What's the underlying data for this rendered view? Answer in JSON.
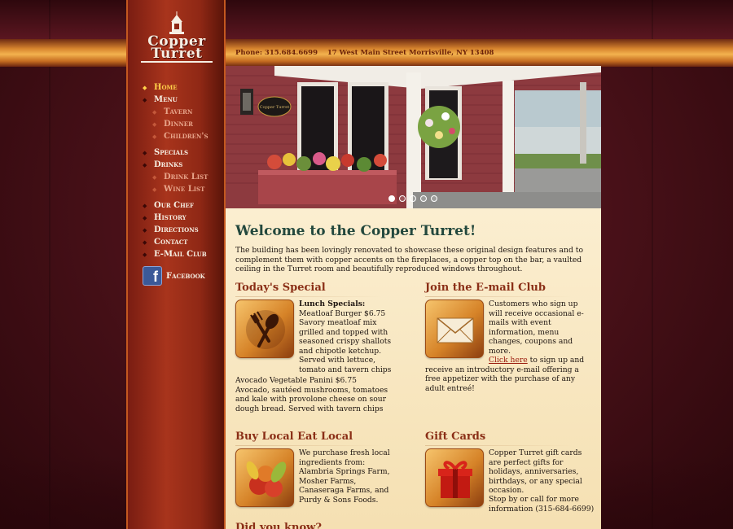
{
  "site": {
    "logo_line1": "Copper",
    "logo_line2": "Turret"
  },
  "header": {
    "contact": "Phone: 315.684.6699    17 West Main Street Morrisville, NY 13408"
  },
  "nav": {
    "home": "Home",
    "menu": "Menu",
    "tavern": "Tavern",
    "dinner": "Dinner",
    "childrens": "Children's",
    "specials": "Specials",
    "drinks": "Drinks",
    "drink_list": "Drink List",
    "wine_list": "Wine List",
    "our_chef": "Our Chef",
    "history": "History",
    "directions": "Directions",
    "contact": "Contact",
    "email_club": "E-Mail Club",
    "facebook": "Facebook"
  },
  "hero": {
    "sign_text": "Copper Turret",
    "slide_count": 5,
    "active_slide": 1
  },
  "main": {
    "welcome_title": "Welcome to the Copper Turret!",
    "intro": "The building has been lovingly renovated to showcase these original design features and to complement them with copper accents on the fireplaces, a copper top on the bar, a vaulted ceiling in the Turret room and beautifully reproduced windows throughout.",
    "special": {
      "title": "Today's Special",
      "lunch_heading": "Lunch Specials:",
      "item1": "Meatloaf Burger $6.75",
      "desc1": "Savory meatloaf mix grilled and topped with seasoned crispy shallots and chipotle ketchup. Served with lettuce, tomato and tavern chips",
      "item2": "Avocado Vegetable Panini $6.75",
      "desc2": "Avocado, sautéed mushrooms, tomatoes and kale with provolone cheese on sour dough bread. Served with tavern chips"
    },
    "email_club": {
      "title": "Join the E-mail Club",
      "text": "Customers who sign up will receive occasional e-mails with event information, menu changes, coupons and more.",
      "link": "Click here",
      "text2": " to sign up and receive an introductory e-mail offering a free appetizer with the purchase of any adult entreé!"
    },
    "buy_local": {
      "title": "Buy Local Eat Local",
      "text": "We purchase fresh local ingredients from: Alambria Springs Farm, Mosher Farms, Canaseraga Farms, and Purdy & Sons Foods."
    },
    "gift_cards": {
      "title": "Gift Cards",
      "text": "Copper Turret gift cards are perfect gifts for holidays, anniversaries, birthdays, or any special occasion.",
      "text2": "Stop by or call for more information (315-684-6699)"
    },
    "next_title": "Did you know?"
  },
  "colors": {
    "accent_copper": "#d7852e",
    "heading_green": "#23483d",
    "heading_red": "#8a2e16",
    "nav_active": "#ffd24a"
  }
}
